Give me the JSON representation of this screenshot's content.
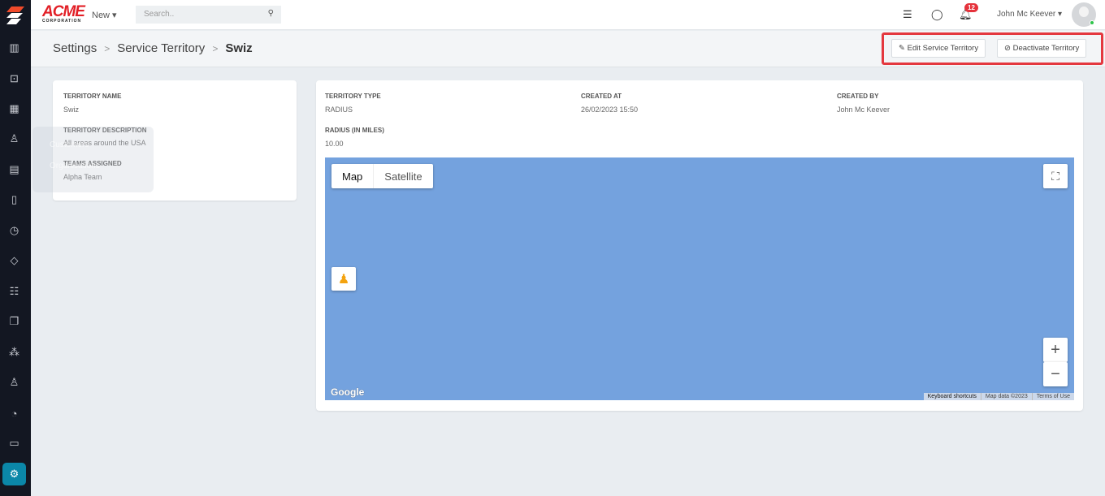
{
  "sidebar": {
    "items": [
      "reports",
      "jobs",
      "calendar",
      "customers",
      "invoices",
      "map",
      "timesheets",
      "tags",
      "forms",
      "documents",
      "inventory",
      "users",
      "dashboard",
      "display",
      "settings"
    ]
  },
  "tooltip": {
    "items": [
      "Customers",
      "Organisations"
    ]
  },
  "topbar": {
    "brand": "ACME",
    "brand_sub": "CORPORATION",
    "new_label": "New ▾",
    "search_placeholder": "Search..",
    "notifications": "12",
    "user": "John Mc Keever ▾"
  },
  "breadcrumb": {
    "items": [
      "Settings",
      "Service Territory"
    ],
    "current": "Swiz"
  },
  "actions": {
    "edit": "Edit Service Territory",
    "deactivate": "Deactivate Territory"
  },
  "left_card": {
    "name_label": "Territory Name",
    "name": "Swiz",
    "desc_label": "Territory Description",
    "desc": "All areas around the USA",
    "teams_label": "Teams Assigned",
    "teams": "Alpha Team"
  },
  "right_card": {
    "type_label": "Territory Type",
    "type": "RADIUS",
    "created_at_label": "Created At",
    "created_at": "26/02/2023 15:50",
    "created_by_label": "Created By",
    "created_by": "John Mc Keever",
    "radius_label": "Radius (in miles)",
    "radius": "10.00"
  },
  "map": {
    "tabs": [
      "Map",
      "Satellite"
    ],
    "logo": "Google",
    "attribution": [
      "Keyboard shortcuts",
      "Map data ©2023",
      "Terms of Use"
    ]
  }
}
